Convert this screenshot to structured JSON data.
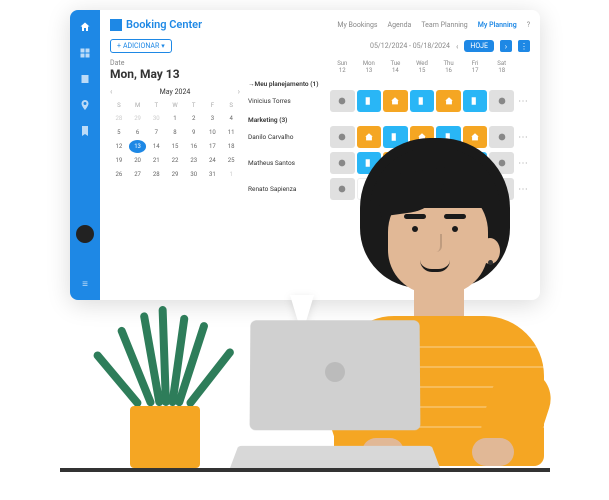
{
  "header": {
    "title": "Booking Center"
  },
  "tabs": [
    "My Bookings",
    "Agenda",
    "Team Planning",
    "My Planning"
  ],
  "activeTab": 3,
  "toolbar": {
    "add": "ADICIONAR",
    "dateRange": "05/12/2024 - 05/18/2024",
    "today": "HOJE"
  },
  "calendar": {
    "label": "Date",
    "current": "Mon, May 13",
    "month": "May 2024",
    "dow": [
      "S",
      "M",
      "T",
      "W",
      "T",
      "F",
      "S"
    ],
    "days": [
      {
        "n": 28,
        "dim": true
      },
      {
        "n": 29,
        "dim": true
      },
      {
        "n": 30,
        "dim": true
      },
      {
        "n": 1
      },
      {
        "n": 2
      },
      {
        "n": 3
      },
      {
        "n": 4
      },
      {
        "n": 5
      },
      {
        "n": 6
      },
      {
        "n": 7
      },
      {
        "n": 8
      },
      {
        "n": 9
      },
      {
        "n": 10
      },
      {
        "n": 11
      },
      {
        "n": 12
      },
      {
        "n": 13,
        "sel": true
      },
      {
        "n": 14
      },
      {
        "n": 15
      },
      {
        "n": 16
      },
      {
        "n": 17
      },
      {
        "n": 18
      },
      {
        "n": 19
      },
      {
        "n": 20
      },
      {
        "n": 21
      },
      {
        "n": 22
      },
      {
        "n": 23
      },
      {
        "n": 24
      },
      {
        "n": 25
      },
      {
        "n": 26
      },
      {
        "n": 27
      },
      {
        "n": 28
      },
      {
        "n": 29
      },
      {
        "n": 30
      },
      {
        "n": 31
      },
      {
        "n": 1,
        "dim": true
      }
    ]
  },
  "planning": {
    "days": [
      {
        "dow": "Sun",
        "d": "12"
      },
      {
        "dow": "Mon",
        "d": "13"
      },
      {
        "dow": "Tue",
        "d": "14"
      },
      {
        "dow": "Wed",
        "d": "15"
      },
      {
        "dow": "Thu",
        "d": "16"
      },
      {
        "dow": "Fri",
        "d": "17"
      },
      {
        "dow": "Sat",
        "d": "18"
      }
    ],
    "sections": [
      {
        "title": "→Meu planejamento (1)",
        "people": [
          {
            "name": "Vinicius Torres",
            "cells": [
              "gray",
              "blue",
              "gold",
              "blue",
              "gold",
              "blue",
              "gray"
            ]
          }
        ]
      },
      {
        "title": "Marketing (3)",
        "people": [
          {
            "name": "Danilo Carvalho",
            "cells": [
              "gray",
              "gold",
              "blue",
              "gold",
              "blue",
              "gold",
              "gray"
            ]
          },
          {
            "name": "Matheus Santos",
            "cells": [
              "gray",
              "blue",
              "gold",
              "blue",
              "gold",
              "blue",
              "gray"
            ]
          },
          {
            "name": "Renato Sapienza",
            "cells": [
              "gray",
              "white",
              "blue",
              "gold",
              "blue",
              "gold",
              "gray"
            ]
          }
        ]
      }
    ]
  }
}
